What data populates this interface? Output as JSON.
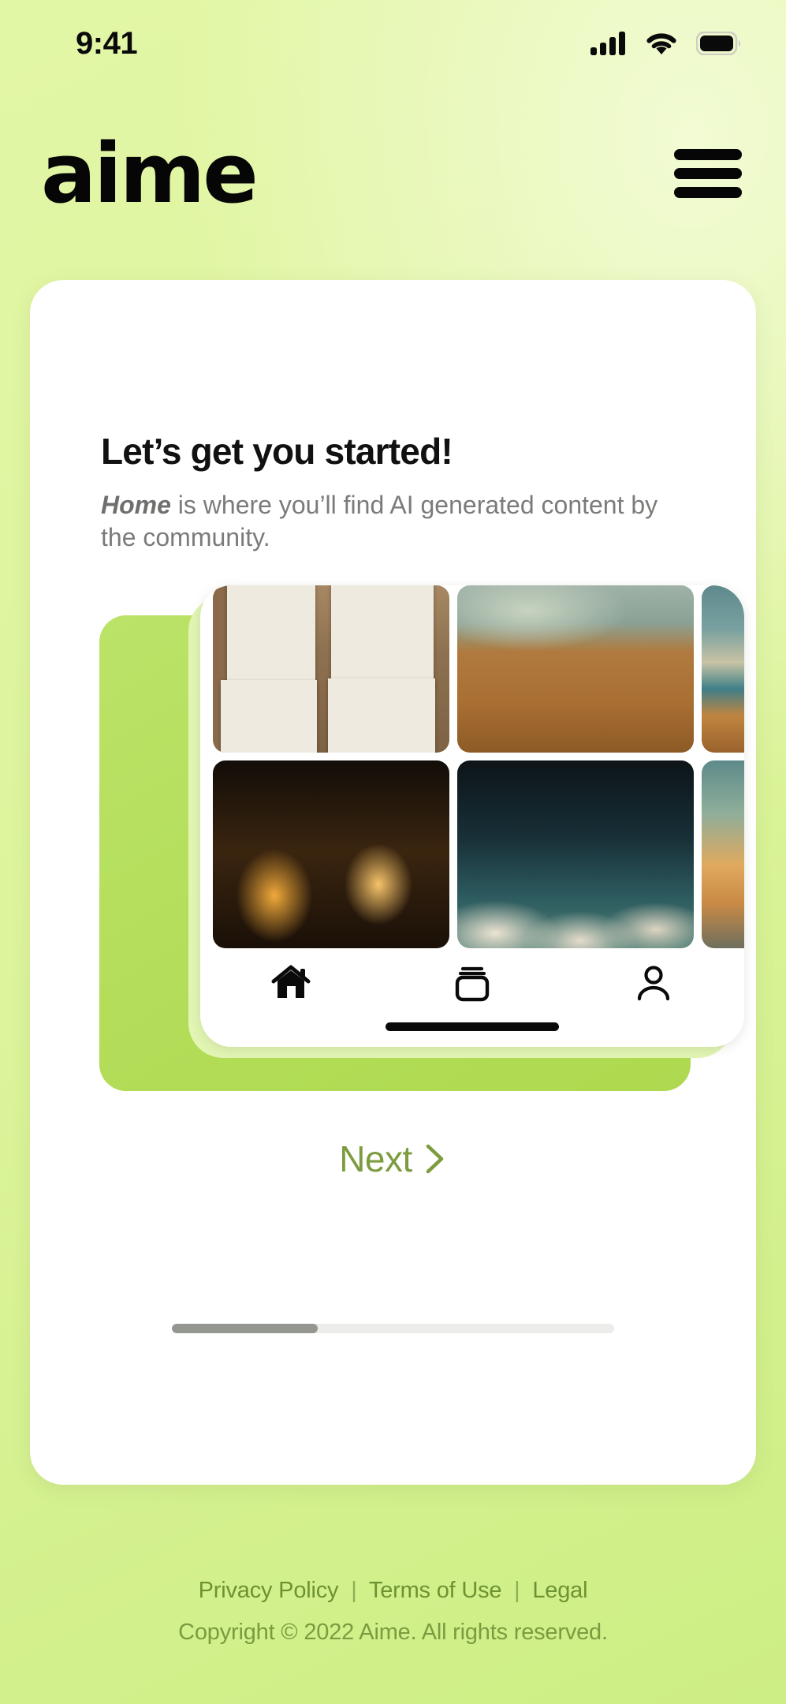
{
  "status_bar": {
    "time": "9:41",
    "cellular_icon": "cellular-signal-icon",
    "wifi_icon": "wifi-icon",
    "battery_icon": "battery-full-icon"
  },
  "header": {
    "logo_text": "aime",
    "menu_icon": "hamburger-menu-icon"
  },
  "card": {
    "headline": "Let’s get you started!",
    "subline_emphasis": "Home",
    "subline_rest": " is where you’ll find AI generated content by the community.",
    "next_label": "Next",
    "next_icon": "chevron-right-icon",
    "progress_percent": 33
  },
  "phone_preview": {
    "nav_items": [
      {
        "icon": "home-icon",
        "name": "home"
      },
      {
        "icon": "card-stack-icon",
        "name": "collections"
      },
      {
        "icon": "person-icon",
        "name": "profile"
      }
    ],
    "home_indicator": "home-indicator-bar",
    "gallery_tiles": [
      {
        "name": "blank-canvas-frames-on-wood",
        "style": "wood"
      },
      {
        "name": "desert-dunes-lake",
        "style": "dunes"
      },
      {
        "name": "glowing-crowd-silhouettes",
        "style": "silhouettes"
      },
      {
        "name": "teal-sky-over-clouds",
        "style": "clouds"
      }
    ]
  },
  "footer": {
    "links": [
      "Privacy Policy",
      "Terms of Use",
      "Legal"
    ],
    "separator": "|",
    "copyright": "Copyright © 2022 Aime. All rights reserved."
  },
  "colors": {
    "background_green": "#ddf49c",
    "accent_green_card": "#b3dd58",
    "accent_text_green": "#7d9c3f",
    "footer_green": "#6d9234",
    "progress_fill": "#93978f",
    "progress_track": "#ececea",
    "card_white": "#ffffff",
    "text_dark": "#111111",
    "text_muted": "#7b7b79"
  }
}
